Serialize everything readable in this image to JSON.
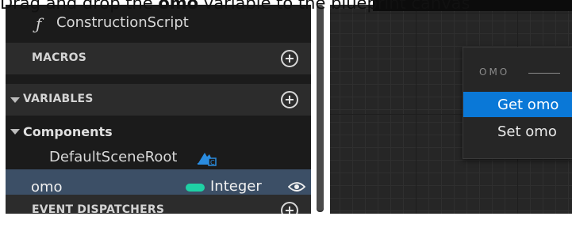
{
  "caption": {
    "before": "Drag and drop the ",
    "variable": "omo",
    "after": " variable to the blueprint canvas"
  },
  "panel": {
    "function_item": "ConstructionScript",
    "macros_label": "MACROS",
    "variables_label": "VARIABLES",
    "components_label": "Components",
    "component_item": "DefaultSceneRoot",
    "variable": {
      "name": "omo",
      "type": "Integer",
      "type_color": "#1fd1a5"
    },
    "dispatchers_label": "EVENT DISPATCHERS",
    "plus_symbol": "+"
  },
  "context_menu": {
    "header": "OMO",
    "items": [
      "Get omo",
      "Set omo"
    ],
    "highlight_color": "#0a78d7"
  }
}
